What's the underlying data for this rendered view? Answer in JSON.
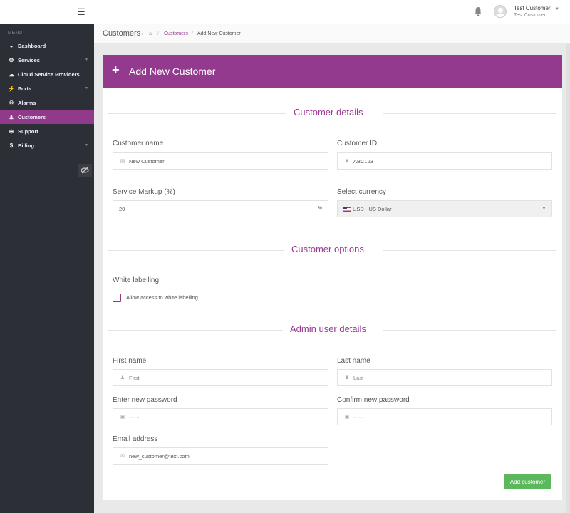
{
  "topbar": {
    "menu_icon": "hamburger-icon",
    "notification_icon": "bell-icon",
    "user": {
      "name": "Test Customer",
      "subtitle": "Test Customer"
    }
  },
  "sidebar": {
    "menu_label": "MENU",
    "items": [
      {
        "label": "Dashboard",
        "icon": "dashboard-icon",
        "glyph": "◒",
        "has_caret": false,
        "active": false
      },
      {
        "label": "Services",
        "icon": "cogs-icon",
        "glyph": "⚙",
        "has_caret": true,
        "active": false
      },
      {
        "label": "Cloud Service Providers",
        "icon": "cloud-icon",
        "glyph": "☁",
        "has_caret": false,
        "active": false
      },
      {
        "label": "Ports",
        "icon": "plug-icon",
        "glyph": "⚡",
        "has_caret": true,
        "active": false
      },
      {
        "label": "Alarms",
        "icon": "bell-icon",
        "glyph": "⍾",
        "has_caret": false,
        "active": false
      },
      {
        "label": "Customers",
        "icon": "user-icon",
        "glyph": "♟",
        "has_caret": false,
        "active": true
      },
      {
        "label": "Support",
        "icon": "life-ring-icon",
        "glyph": "⊕",
        "has_caret": false,
        "active": false
      },
      {
        "label": "Billing",
        "icon": "dollar-icon",
        "glyph": "$",
        "has_caret": true,
        "active": false
      }
    ],
    "collapse_icon": "eye-slash-icon"
  },
  "header": {
    "page_title": "Customers",
    "breadcrumb": [
      {
        "label": "",
        "icon": "home-icon"
      },
      {
        "label": "Customers"
      },
      {
        "label": "Add New Customer"
      }
    ]
  },
  "card": {
    "title": "Add New Customer",
    "sections": {
      "customer_details": "Customer details",
      "customer_options": "Customer options",
      "admin_user_details": "Admin user details"
    },
    "fields": {
      "customer_name": {
        "label": "Customer name",
        "value": "New Customer",
        "icon": "briefcase-icon"
      },
      "customer_id": {
        "label": "Customer ID",
        "value": "ABC123",
        "icon": "user-icon"
      },
      "service_markup": {
        "label": "Service Markup (%)",
        "value": "20",
        "suffix": "%"
      },
      "currency": {
        "label": "Select currency",
        "value": "USD - US Dollar",
        "icon": "us-flag-icon"
      },
      "white_labelling": {
        "label": "White labelling",
        "checkbox_label": "Allow access to white labelling",
        "checked": false
      },
      "first_name": {
        "label": "First name",
        "placeholder": "First",
        "icon": "user-icon"
      },
      "last_name": {
        "label": "Last name",
        "placeholder": "Last",
        "icon": "user-icon"
      },
      "new_password": {
        "label": "Enter new password",
        "value": "······",
        "icon": "lock-icon"
      },
      "confirm_password": {
        "label": "Confirm new password",
        "value": "······",
        "icon": "lock-icon"
      },
      "email": {
        "label": "Email address",
        "value": "new_customer@text.com",
        "icon": "envelope-icon"
      }
    },
    "submit_label": "Add customer"
  },
  "colors": {
    "brand_purple": "#933a8e",
    "sidebar_bg": "#2c2f36",
    "success_green": "#5cb85c"
  }
}
